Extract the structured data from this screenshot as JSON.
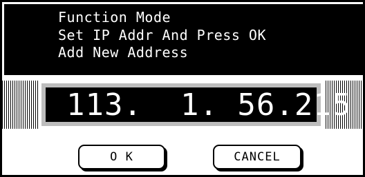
{
  "header": {
    "line1": "Function Mode",
    "line2": "Set IP Addr And Press OK",
    "line3": "Add New Address"
  },
  "address_field": {
    "value": "113.  1. 56.215"
  },
  "buttons": {
    "ok_label": "O K",
    "cancel_label": "CANCEL"
  },
  "colors": {
    "background": "#ffffff",
    "header_bg": "#000000",
    "text_on_dark": "#ffffff",
    "field_border": "#bdbdbd"
  }
}
